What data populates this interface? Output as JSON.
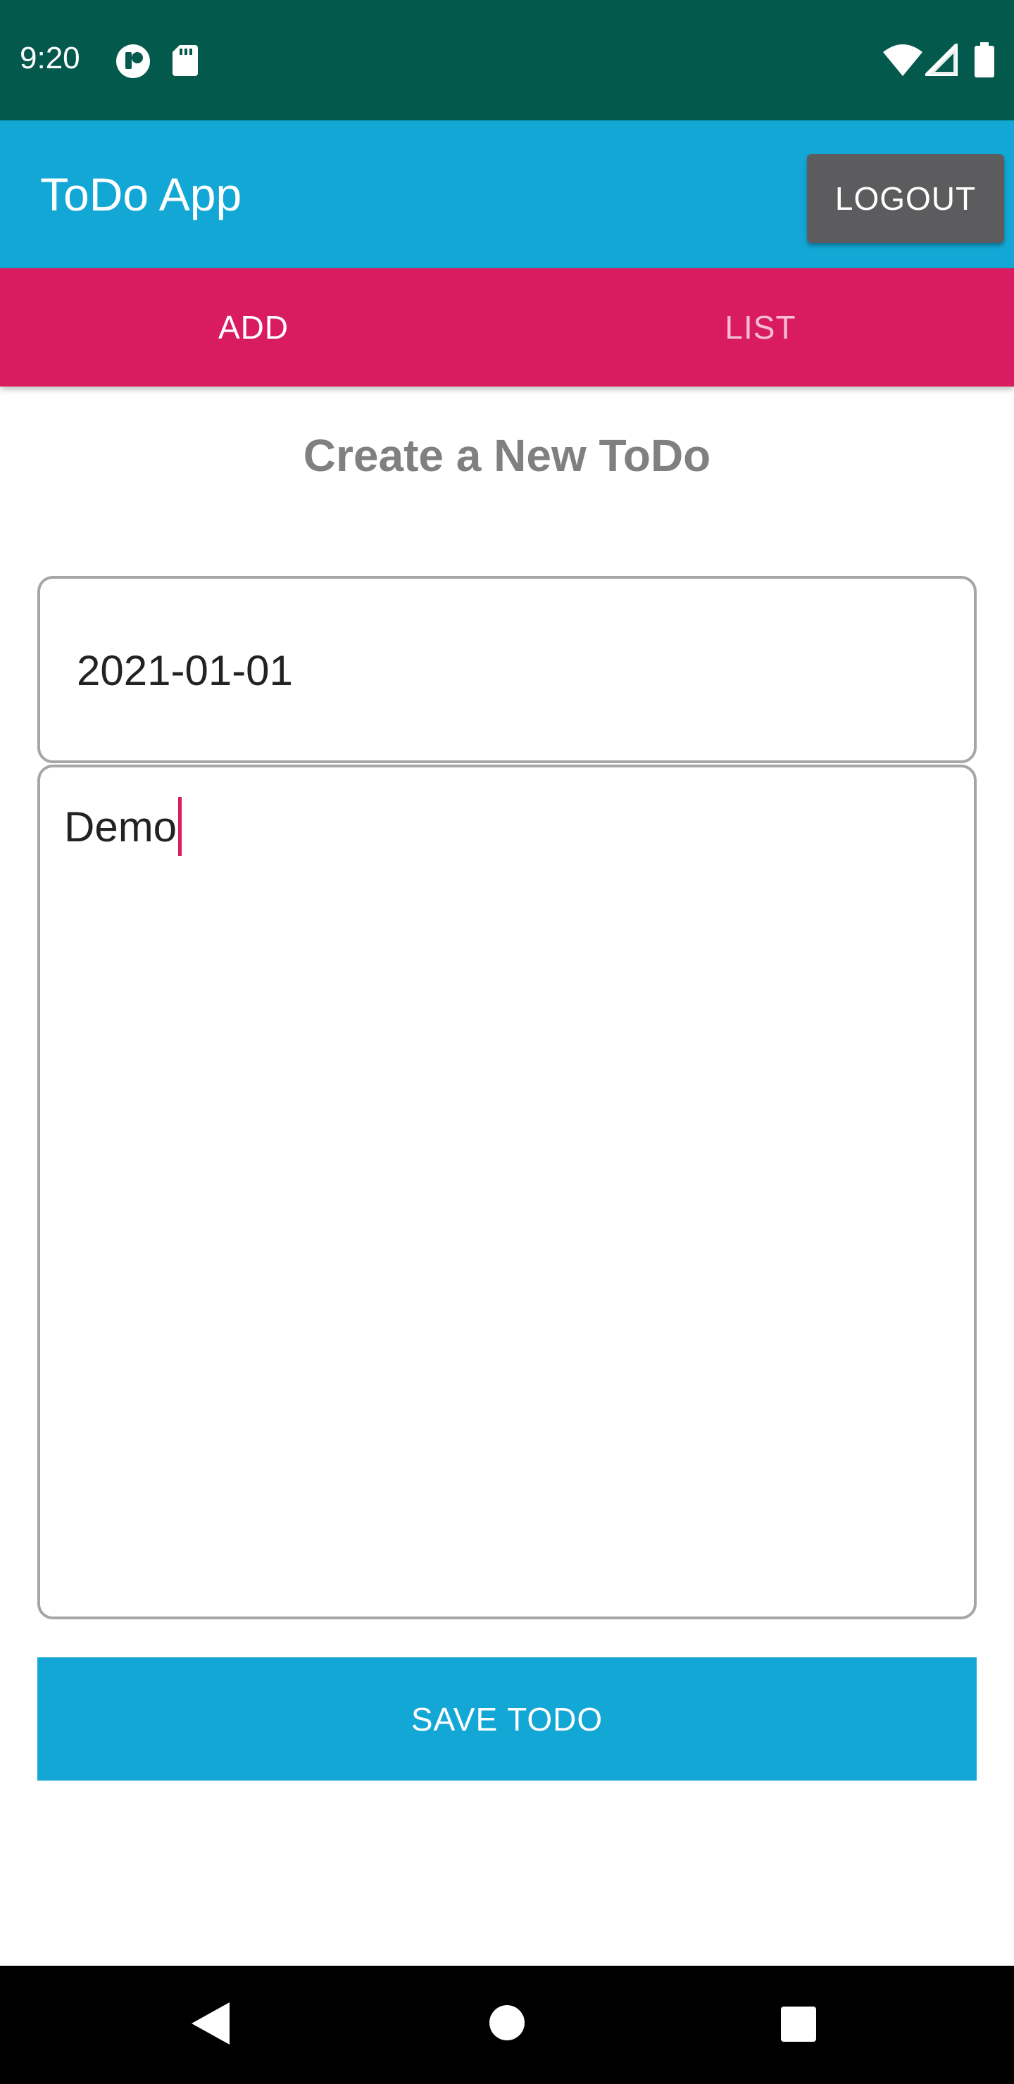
{
  "status_bar": {
    "time": "9:20",
    "left_icons": [
      "app-notification-icon",
      "sd-card-icon"
    ],
    "right_icons": [
      "wifi-icon",
      "cell-signal-icon",
      "battery-icon"
    ],
    "background": "#03594b"
  },
  "app_bar": {
    "title": "ToDo App",
    "logout_label": "LOGOUT",
    "background": "#13a7d6"
  },
  "tabs": [
    {
      "label": "ADD",
      "selected": true
    },
    {
      "label": "LIST",
      "selected": false
    }
  ],
  "tab_bar_color": "#d91b60",
  "form": {
    "heading": "Create a New ToDo",
    "date_value": "2021-01-01",
    "description_value": "Demo",
    "save_label": "SAVE TODO"
  },
  "nav_bar": {
    "buttons": [
      "back-icon",
      "home-icon",
      "recents-icon"
    ]
  }
}
